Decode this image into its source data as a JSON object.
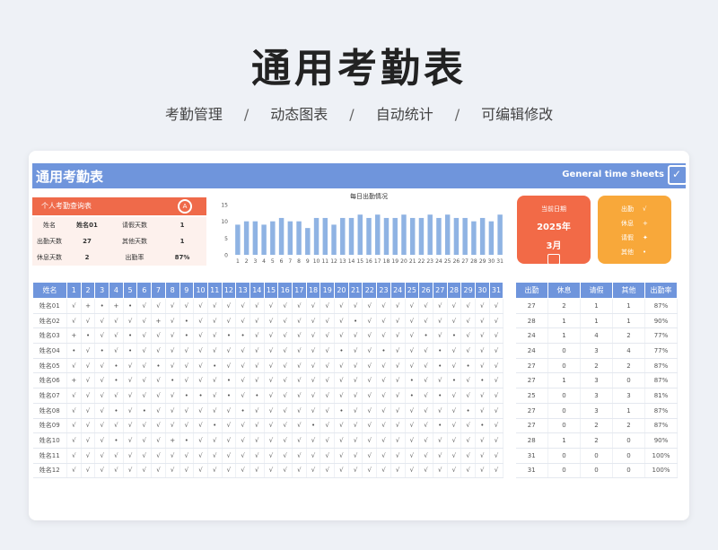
{
  "page": {
    "title": "通用考勤表",
    "tags": [
      "考勤管理",
      "动态图表",
      "自动统计",
      "可编辑修改"
    ],
    "seps": [
      "/",
      "/",
      "/"
    ]
  },
  "banner": {
    "title": "通用考勤表",
    "subtitle_en": "General time sheets",
    "icon": "calendar-check-icon"
  },
  "query": {
    "title": "个人考勤查询表",
    "rows": [
      {
        "k1": "姓名",
        "v1": "姓名01",
        "k2": "请假天数",
        "v2": "1"
      },
      {
        "k1": "出勤天数",
        "v1": "27",
        "k2": "其他天数",
        "v2": "1"
      },
      {
        "k1": "休息天数",
        "v1": "2",
        "k2": "出勤率",
        "v2": "87%"
      }
    ]
  },
  "chart_data": {
    "type": "bar",
    "title": "每日出勤情况",
    "categories": [
      "1",
      "2",
      "3",
      "4",
      "5",
      "6",
      "7",
      "8",
      "9",
      "10",
      "11",
      "12",
      "13",
      "14",
      "15",
      "16",
      "17",
      "18",
      "19",
      "20",
      "21",
      "22",
      "23",
      "24",
      "25",
      "26",
      "27",
      "28",
      "29",
      "30",
      "31"
    ],
    "values": [
      9,
      10,
      10,
      9,
      10,
      11,
      10,
      10,
      8,
      11,
      11,
      9,
      11,
      11,
      12,
      11,
      12,
      11,
      11,
      12,
      11,
      11,
      12,
      11,
      12,
      11,
      11,
      10,
      11,
      10,
      12
    ],
    "yticks": [
      0,
      5,
      10,
      15
    ],
    "ylim": [
      0,
      15
    ],
    "color": "#8fb3e3"
  },
  "date_card": {
    "label": "当前日期",
    "year": "2025年",
    "month": "3月",
    "icon": "calendar-icon"
  },
  "legend": [
    {
      "name": "出勤",
      "sym": "√"
    },
    {
      "name": "休息",
      "sym": "+"
    },
    {
      "name": "请假",
      "sym": "✦"
    },
    {
      "name": "其他",
      "sym": "•"
    }
  ],
  "table": {
    "name_header": "姓名",
    "days": [
      "1",
      "2",
      "3",
      "4",
      "5",
      "6",
      "7",
      "8",
      "9",
      "10",
      "11",
      "12",
      "13",
      "14",
      "15",
      "16",
      "17",
      "18",
      "19",
      "20",
      "21",
      "22",
      "23",
      "24",
      "25",
      "26",
      "27",
      "28",
      "29",
      "30",
      "31"
    ],
    "rows": [
      {
        "name": "姓名01",
        "marks": [
          "√",
          "+",
          "•",
          "+",
          "•",
          "√",
          "√",
          "√",
          "√",
          "√",
          "√",
          "√",
          "√",
          "√",
          "√",
          "√",
          "√",
          "√",
          "√",
          "√",
          "√",
          "√",
          "√",
          "√",
          "√",
          "√",
          "√",
          "√",
          "√",
          "√",
          "√"
        ]
      },
      {
        "name": "姓名02",
        "marks": [
          "√",
          "√",
          "√",
          "√",
          "√",
          "√",
          "+",
          "√",
          "•",
          "√",
          "√",
          "√",
          "√",
          "√",
          "√",
          "√",
          "√",
          "√",
          "√",
          "√",
          "•",
          "√",
          "√",
          "√",
          "√",
          "√",
          "√",
          "√",
          "√",
          "√",
          "√"
        ]
      },
      {
        "name": "姓名03",
        "marks": [
          "+",
          "•",
          "√",
          "√",
          "•",
          "√",
          "√",
          "√",
          "•",
          "√",
          "√",
          "•",
          "•",
          "√",
          "√",
          "√",
          "√",
          "√",
          "√",
          "√",
          "√",
          "√",
          "√",
          "√",
          "√",
          "•",
          "√",
          "•",
          "√",
          "√",
          "√"
        ]
      },
      {
        "name": "姓名04",
        "marks": [
          "•",
          "√",
          "•",
          "√",
          "•",
          "√",
          "√",
          "√",
          "√",
          "√",
          "√",
          "√",
          "√",
          "√",
          "√",
          "√",
          "√",
          "√",
          "√",
          "•",
          "√",
          "√",
          "•",
          "√",
          "√",
          "√",
          "•",
          "√",
          "√",
          "√",
          "√"
        ]
      },
      {
        "name": "姓名05",
        "marks": [
          "√",
          "√",
          "√",
          "•",
          "√",
          "√",
          "•",
          "√",
          "√",
          "√",
          "•",
          "√",
          "√",
          "√",
          "√",
          "√",
          "√",
          "√",
          "√",
          "√",
          "√",
          "√",
          "√",
          "√",
          "√",
          "√",
          "•",
          "√",
          "•",
          "√",
          "√"
        ]
      },
      {
        "name": "姓名06",
        "marks": [
          "+",
          "√",
          "√",
          "•",
          "√",
          "√",
          "√",
          "•",
          "√",
          "√",
          "√",
          "•",
          "√",
          "√",
          "√",
          "√",
          "√",
          "√",
          "√",
          "√",
          "√",
          "√",
          "√",
          "√",
          "•",
          "√",
          "√",
          "•",
          "√",
          "•",
          "√"
        ]
      },
      {
        "name": "姓名07",
        "marks": [
          "√",
          "√",
          "√",
          "√",
          "√",
          "√",
          "√",
          "√",
          "•",
          "•",
          "√",
          "•",
          "√",
          "•",
          "√",
          "√",
          "√",
          "√",
          "√",
          "√",
          "√",
          "√",
          "√",
          "√",
          "•",
          "√",
          "•",
          "√",
          "√",
          "√",
          "√"
        ]
      },
      {
        "name": "姓名08",
        "marks": [
          "√",
          "√",
          "√",
          "•",
          "√",
          "•",
          "√",
          "√",
          "√",
          "√",
          "√",
          "√",
          "•",
          "√",
          "√",
          "√",
          "√",
          "√",
          "√",
          "•",
          "√",
          "√",
          "√",
          "√",
          "√",
          "√",
          "√",
          "√",
          "•",
          "√",
          "√"
        ]
      },
      {
        "name": "姓名09",
        "marks": [
          "√",
          "√",
          "√",
          "√",
          "√",
          "√",
          "√",
          "√",
          "√",
          "√",
          "•",
          "√",
          "√",
          "√",
          "√",
          "√",
          "√",
          "•",
          "√",
          "√",
          "√",
          "√",
          "√",
          "√",
          "√",
          "√",
          "•",
          "√",
          "√",
          "•",
          "√"
        ]
      },
      {
        "name": "姓名10",
        "marks": [
          "√",
          "√",
          "√",
          "•",
          "√",
          "√",
          "√",
          "+",
          "•",
          "√",
          "√",
          "√",
          "√",
          "√",
          "√",
          "√",
          "√",
          "√",
          "√",
          "√",
          "√",
          "√",
          "√",
          "√",
          "√",
          "√",
          "√",
          "√",
          "√",
          "√",
          "√"
        ]
      },
      {
        "name": "姓名11",
        "marks": [
          "√",
          "√",
          "√",
          "√",
          "√",
          "√",
          "√",
          "√",
          "√",
          "√",
          "√",
          "√",
          "√",
          "√",
          "√",
          "√",
          "√",
          "√",
          "√",
          "√",
          "√",
          "√",
          "√",
          "√",
          "√",
          "√",
          "√",
          "√",
          "√",
          "√",
          "√"
        ]
      },
      {
        "name": "姓名12",
        "marks": [
          "√",
          "√",
          "√",
          "√",
          "√",
          "√",
          "√",
          "√",
          "√",
          "√",
          "√",
          "√",
          "√",
          "√",
          "√",
          "√",
          "√",
          "√",
          "√",
          "√",
          "√",
          "√",
          "√",
          "√",
          "√",
          "√",
          "√",
          "√",
          "√",
          "√",
          "√"
        ]
      }
    ]
  },
  "stats": {
    "headers": [
      "出勤",
      "休息",
      "请假",
      "其他",
      "出勤率"
    ],
    "rows": [
      [
        "27",
        "2",
        "1",
        "1",
        "87%"
      ],
      [
        "28",
        "1",
        "1",
        "1",
        "90%"
      ],
      [
        "24",
        "1",
        "4",
        "2",
        "77%"
      ],
      [
        "24",
        "0",
        "3",
        "4",
        "77%"
      ],
      [
        "27",
        "0",
        "2",
        "2",
        "87%"
      ],
      [
        "27",
        "1",
        "3",
        "0",
        "87%"
      ],
      [
        "25",
        "0",
        "3",
        "3",
        "81%"
      ],
      [
        "27",
        "0",
        "3",
        "1",
        "87%"
      ],
      [
        "27",
        "0",
        "2",
        "2",
        "87%"
      ],
      [
        "28",
        "1",
        "2",
        "0",
        "90%"
      ],
      [
        "31",
        "0",
        "0",
        "0",
        "100%"
      ],
      [
        "31",
        "0",
        "0",
        "0",
        "100%"
      ]
    ]
  }
}
